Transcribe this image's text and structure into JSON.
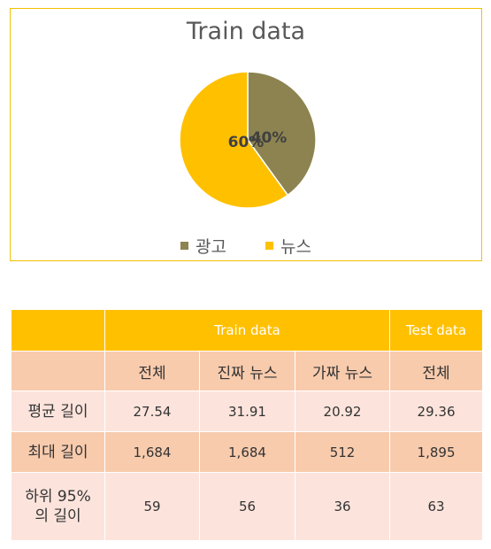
{
  "chart_data": {
    "type": "pie",
    "title": "Train data",
    "categories": [
      "광고",
      "뉴스"
    ],
    "values": [
      40,
      60
    ],
    "labels": [
      "40%",
      "60%"
    ],
    "colors": [
      "#8c8350",
      "#ffc000"
    ],
    "legend_position": "bottom"
  },
  "table": {
    "header": {
      "corner": "",
      "train": "Train data",
      "test": "Test data"
    },
    "subheader": [
      "",
      "전체",
      "진짜 뉴스",
      "가짜 뉴스",
      "전체"
    ],
    "rows": [
      {
        "label_line1": "평균 길이",
        "label_line2": "",
        "values": [
          "27.54",
          "31.91",
          "20.92",
          "29.36"
        ]
      },
      {
        "label_line1": "최대 길이",
        "label_line2": "",
        "values": [
          "1,684",
          "1,684",
          "512",
          "1,895"
        ]
      },
      {
        "label_line1": "하위 95%",
        "label_line2": "의 길이",
        "values": [
          "59",
          "56",
          "36",
          "63"
        ]
      }
    ]
  }
}
